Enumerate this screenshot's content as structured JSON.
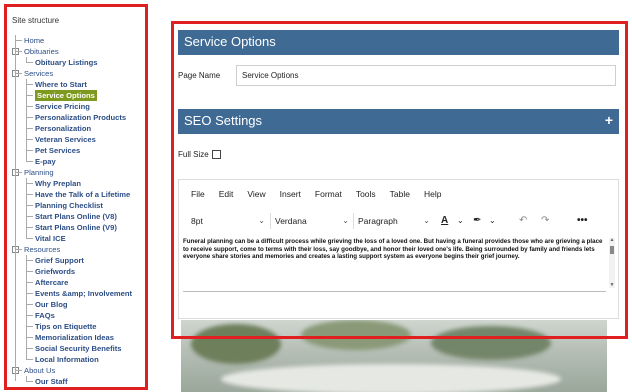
{
  "sidebar": {
    "title": "Site structure",
    "items": [
      {
        "label": "Home",
        "level": 0,
        "toggle": ""
      },
      {
        "label": "Obituaries",
        "level": 0,
        "toggle": "-"
      },
      {
        "label": "Obituary Listings",
        "level": 1
      },
      {
        "label": "Services",
        "level": 0,
        "toggle": "-"
      },
      {
        "label": "Where to Start",
        "level": 1
      },
      {
        "label": "Service Options",
        "level": 1,
        "selected": true
      },
      {
        "label": "Service Pricing",
        "level": 1
      },
      {
        "label": "Personalization Products",
        "level": 1
      },
      {
        "label": "Personalization",
        "level": 1
      },
      {
        "label": "Veteran Services",
        "level": 1
      },
      {
        "label": "Pet Services",
        "level": 1
      },
      {
        "label": "E-pay",
        "level": 1
      },
      {
        "label": "Planning",
        "level": 0,
        "toggle": "-"
      },
      {
        "label": "Why Preplan",
        "level": 1
      },
      {
        "label": "Have the Talk of a Lifetime",
        "level": 1
      },
      {
        "label": "Planning Checklist",
        "level": 1
      },
      {
        "label": "Start Plans Online (V8)",
        "level": 1
      },
      {
        "label": "Start Plans Online (V9)",
        "level": 1
      },
      {
        "label": "Vital ICE",
        "level": 1
      },
      {
        "label": "Resources",
        "level": 0,
        "toggle": "-"
      },
      {
        "label": "Grief Support",
        "level": 1
      },
      {
        "label": "Griefwords",
        "level": 1
      },
      {
        "label": "Aftercare",
        "level": 1
      },
      {
        "label": "Events &amp; Involvement",
        "level": 1
      },
      {
        "label": "Our Blog",
        "level": 1
      },
      {
        "label": "FAQs",
        "level": 1
      },
      {
        "label": "Tips on Etiquette",
        "level": 1
      },
      {
        "label": "Memorialization Ideas",
        "level": 1
      },
      {
        "label": "Social Security Benefits",
        "level": 1
      },
      {
        "label": "Local Information",
        "level": 1
      },
      {
        "label": "About Us",
        "level": 0,
        "toggle": "-"
      },
      {
        "label": "Our Staff",
        "level": 1
      }
    ]
  },
  "service_options": {
    "header": "Service Options",
    "page_name_label": "Page Name",
    "page_name_value": "Service Options"
  },
  "seo": {
    "header": "SEO Settings",
    "expand_icon": "+",
    "full_size_label": "Full Size"
  },
  "editor": {
    "menu": [
      "File",
      "Edit",
      "View",
      "Insert",
      "Format",
      "Tools",
      "Table",
      "Help"
    ],
    "font_size": "8pt",
    "font_family": "Verdana",
    "block_format": "Paragraph",
    "content": "Funeral planning can be a difficult process while grieving the loss of a loved one. But having a funeral provides those who are grieving a place to receive support, come to terms with their loss, say goodbye, and honor their loved one's life. Being surrounded by family and friends lets everyone share stories and memories and creates a lasting support system as everyone begins their grief journey."
  },
  "colors": {
    "band": "#3f6a94",
    "highlight": "#e02020",
    "selected_item": "#7d9a1f",
    "link": "#2c4e86"
  }
}
